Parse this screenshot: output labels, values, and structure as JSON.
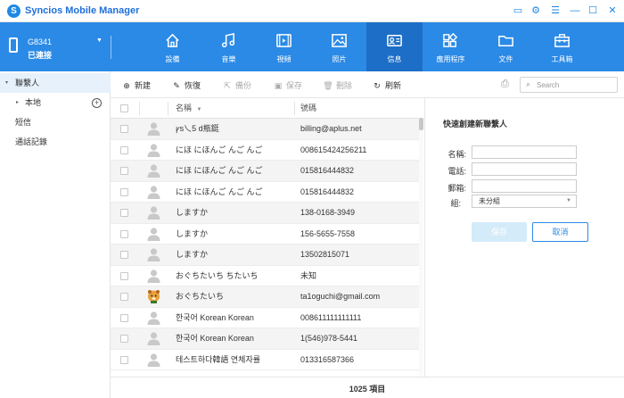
{
  "app": {
    "title": "Syncios Mobile Manager",
    "logo": "S"
  },
  "window_controls": [
    {
      "icon": "screen-icon",
      "glyph": "▭"
    },
    {
      "icon": "gear-icon",
      "glyph": "⚙"
    },
    {
      "icon": "menu-icon",
      "glyph": "☰"
    },
    {
      "icon": "minimize-icon",
      "glyph": "—"
    },
    {
      "icon": "maximize-icon",
      "glyph": "☐"
    },
    {
      "icon": "close-icon",
      "glyph": "✕"
    }
  ],
  "device": {
    "name": "G8341",
    "status": "已連接"
  },
  "nav": [
    {
      "label": "設備",
      "icon": "home-icon",
      "active": false
    },
    {
      "label": "音樂",
      "icon": "music-icon",
      "active": false
    },
    {
      "label": "視頻",
      "icon": "video-icon",
      "active": false
    },
    {
      "label": "照片",
      "icon": "photo-icon",
      "active": false
    },
    {
      "label": "信息",
      "icon": "contact-card-icon",
      "active": true
    },
    {
      "label": "應用程序",
      "icon": "apps-icon",
      "active": false
    },
    {
      "label": "文件",
      "icon": "folder-icon",
      "active": false
    },
    {
      "label": "工具箱",
      "icon": "toolbox-icon",
      "active": false
    }
  ],
  "sidebar": {
    "items": [
      {
        "label": "聯繫人",
        "active": true,
        "caret": "▾"
      },
      {
        "label": "本地",
        "active": false,
        "caret": "▸"
      },
      {
        "label": "短信",
        "active": false,
        "caret": ""
      },
      {
        "label": "通話記錄",
        "active": false,
        "caret": ""
      }
    ]
  },
  "toolbar": {
    "new": "新建",
    "restore": "恢復",
    "backup": "備份",
    "save": "保存",
    "delete": "刪除",
    "refresh": "刷新"
  },
  "search": {
    "placeholder": "Search"
  },
  "table": {
    "headers": {
      "name": "名稱",
      "phone": "號碼"
    },
    "rows": [
      {
        "name": "ꝩs乀5 d瓶鋌",
        "phone": "billing@aplus.net",
        "avatar": "default"
      },
      {
        "name": "にほ にほんご んご んご",
        "phone": "008615424256211",
        "avatar": "default"
      },
      {
        "name": "にほ にほんご んご んご",
        "phone": "015816444832",
        "avatar": "default"
      },
      {
        "name": "にほ にほんご んご んご",
        "phone": "015816444832",
        "avatar": "default"
      },
      {
        "name": "しますか",
        "phone": "138-0168-3949",
        "avatar": "default"
      },
      {
        "name": "しますか",
        "phone": "156-5655-7558",
        "avatar": "default"
      },
      {
        "name": "しますか",
        "phone": "13502815071",
        "avatar": "default"
      },
      {
        "name": "おぐちたいち ちたいち",
        "phone": "未知",
        "avatar": "default"
      },
      {
        "name": "おぐちたいち",
        "phone": "ta1oguchi@gmail.com",
        "avatar": "photo"
      },
      {
        "name": "한국어 Korean Korean",
        "phone": "008611111111111",
        "avatar": "default"
      },
      {
        "name": "한국어 Korean Korean",
        "phone": "1(546)978-5441",
        "avatar": "default"
      },
      {
        "name": "테스트하다韓語 연체자률",
        "phone": "013316587366",
        "avatar": "default"
      }
    ]
  },
  "footer": {
    "count": "1025 項目"
  },
  "quick_create": {
    "title": "快速創建新聯繫人",
    "name_label": "名稱:",
    "phone_label": "電話:",
    "email_label": "郵箱:",
    "group_label": "組:",
    "group_value": "未分組",
    "save": "保存",
    "cancel": "取消"
  },
  "colors": {
    "accent": "#2b8ae6",
    "accent_dark": "#1d6ec6",
    "title": "#1e6fd9"
  }
}
